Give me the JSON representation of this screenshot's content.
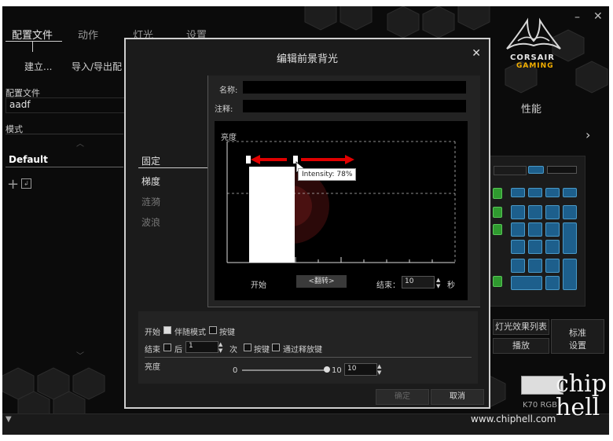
{
  "nav": {
    "tabs": [
      "配置文件",
      "动作",
      "灯光",
      "设置"
    ],
    "sub": [
      "建立...",
      "导入/导出配"
    ]
  },
  "sidebar": {
    "profile_label": "配置文件",
    "profile_value": "aadf",
    "mode_label": "模式",
    "mode_item": "Default"
  },
  "brand": {
    "line1": "CORSAIR",
    "line2": "GAMING"
  },
  "right": {
    "perf": "性能",
    "effects_list": "灯光效果列表",
    "play": "播放",
    "standard": "标准",
    "settings": "设置",
    "device": "K70 RGB"
  },
  "watermark": {
    "site": "www.chiphell.com",
    "logo": "chip hell"
  },
  "dialog": {
    "title": "编辑前景背光",
    "name_label": "名称:",
    "note_label": "注释:",
    "menu": [
      "固定",
      "梯度",
      "涟漪",
      "波浪"
    ],
    "brightness_label": "亮度",
    "tooltip": "Intensity: 78%",
    "start_label": "开始",
    "flip_btn": "<翻转>",
    "end_label": "结束：",
    "end_value": "10",
    "unit_sec": "秒",
    "opt": {
      "start": "开始",
      "follow_mode": "伴随模式",
      "keypress": "按键",
      "end": "结束",
      "after": "后",
      "after_value": "1",
      "times": "次",
      "keypress2": "按键",
      "release": "通过释放键"
    },
    "brightness": {
      "label": "亮度",
      "min": "0",
      "max": "10",
      "value": "10"
    },
    "ok": "确定",
    "cancel": "取消"
  }
}
